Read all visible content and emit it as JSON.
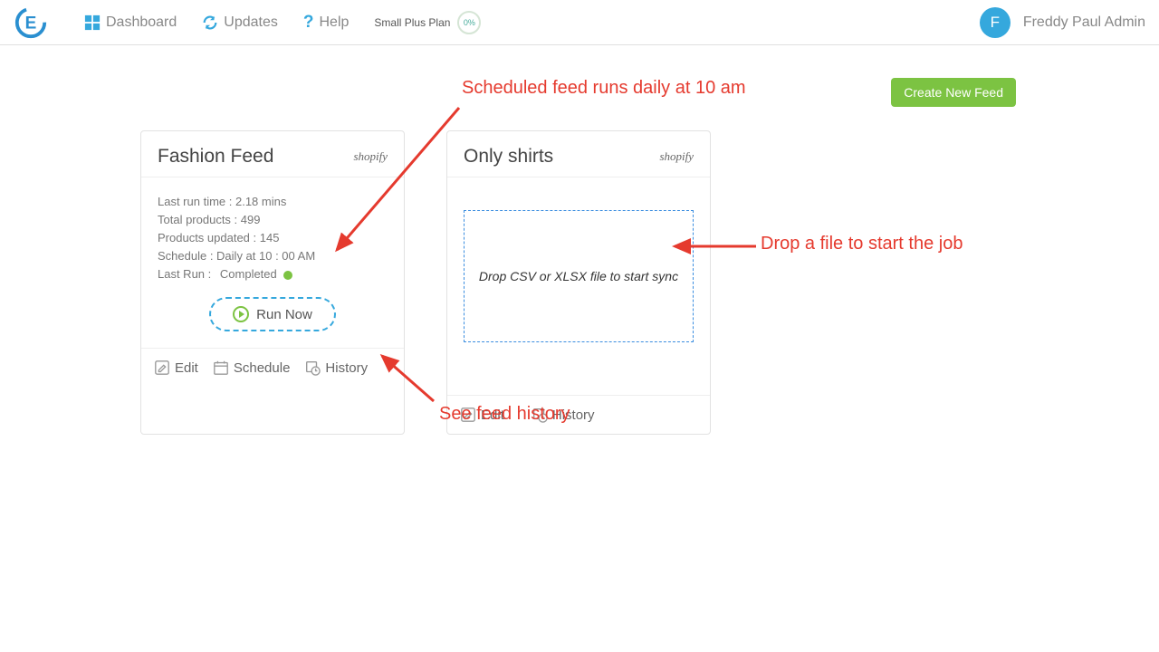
{
  "nav": {
    "dashboard": "Dashboard",
    "updates": "Updates",
    "help": "Help",
    "plan": "Small Plus Plan",
    "pct": "0%"
  },
  "user": {
    "initial": "F",
    "name": "Freddy Paul Admin"
  },
  "buttons": {
    "create": "Create New Feed",
    "run_now": "Run Now"
  },
  "feeds": [
    {
      "title": "Fashion Feed",
      "platform": "shopify",
      "stats": {
        "last_run_time": "Last run time : 2.18 mins",
        "total_products": "Total products : 499",
        "products_updated": "Products updated : 145",
        "schedule": "Schedule : Daily at 10 : 00 AM",
        "last_run_label": "Last Run :",
        "last_run_status": "Completed"
      },
      "foot": {
        "edit": "Edit",
        "schedule": "Schedule",
        "history": "History"
      }
    },
    {
      "title": "Only shirts",
      "platform": "shopify",
      "drop_text": "Drop CSV or XLSX file to start sync",
      "foot": {
        "edit": "Edit",
        "history": "History"
      }
    }
  ],
  "annotations": {
    "a1": "Scheduled feed runs daily at 10 am",
    "a2": "Drop a file to start the job",
    "a3": "See feed history"
  }
}
